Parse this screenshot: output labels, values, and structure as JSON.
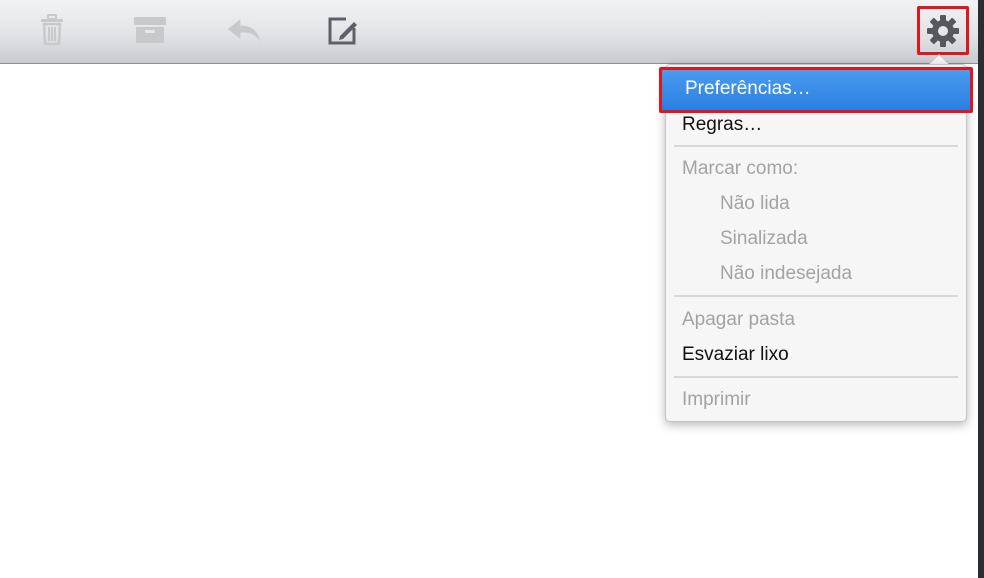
{
  "toolbar": {
    "buttons": [
      {
        "icon": "trash-icon",
        "enabled": false
      },
      {
        "icon": "archive-icon",
        "enabled": false
      },
      {
        "icon": "reply-icon",
        "enabled": false
      },
      {
        "icon": "compose-icon",
        "enabled": true
      },
      {
        "icon": "gear-icon",
        "enabled": true,
        "highlighted": true
      }
    ]
  },
  "menu": {
    "preferences": "Preferências…",
    "rules": "Regras…",
    "mark_as": "Marcar como:",
    "unread": "Não lida",
    "flagged": "Sinalizada",
    "not_junk": "Não indesejada",
    "delete_folder": "Apagar pasta",
    "empty_trash": "Esvaziar lixo",
    "print": "Imprimir"
  },
  "colors": {
    "highlight": "#2b7fe0",
    "callout_border": "#e0161e",
    "disabled_text": "#a3a3a3",
    "enabled_text": "#111111"
  }
}
